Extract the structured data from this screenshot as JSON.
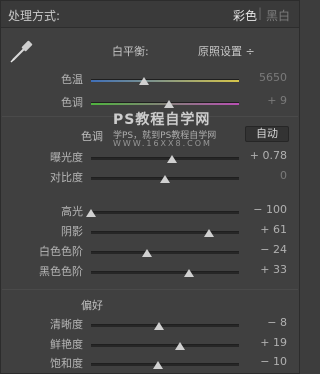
{
  "header": {
    "title": "处理方式:",
    "treatment_color": "彩色",
    "treatment_separator": "|",
    "treatment_bw": "黑白"
  },
  "white_balance": {
    "label": "白平衡:",
    "preset": "原照设置 ÷"
  },
  "watermark": {
    "line1": "PS教程自学网",
    "line2": "学PS，就到PS教程自学网",
    "line3": "WWW.16XX8.COM"
  },
  "tone": {
    "tag": "色调",
    "auto_label": "自动"
  },
  "presence": {
    "tag": "偏好"
  },
  "sliders": {
    "temp": {
      "label": "色温",
      "value": "5650",
      "pos": 0.36
    },
    "tint": {
      "label": "色调",
      "value": "+ 9",
      "pos": 0.53
    },
    "exposure": {
      "label": "曝光度",
      "value": "+ 0.78",
      "pos": 0.55
    },
    "contrast": {
      "label": "对比度",
      "value": "0",
      "pos": 0.5
    },
    "highlights": {
      "label": "高光",
      "value": "− 100",
      "pos": 0.0
    },
    "shadows": {
      "label": "阴影",
      "value": "+ 61",
      "pos": 0.8
    },
    "whites": {
      "label": "白色色阶",
      "value": "− 24",
      "pos": 0.38
    },
    "blacks": {
      "label": "黑色色阶",
      "value": "+ 33",
      "pos": 0.66
    },
    "clarity": {
      "label": "清晰度",
      "value": "− 8",
      "pos": 0.46
    },
    "vibrance": {
      "label": "鲜艳度",
      "value": "+ 19",
      "pos": 0.6
    },
    "saturation": {
      "label": "饱和度",
      "value": "− 10",
      "pos": 0.45
    }
  }
}
